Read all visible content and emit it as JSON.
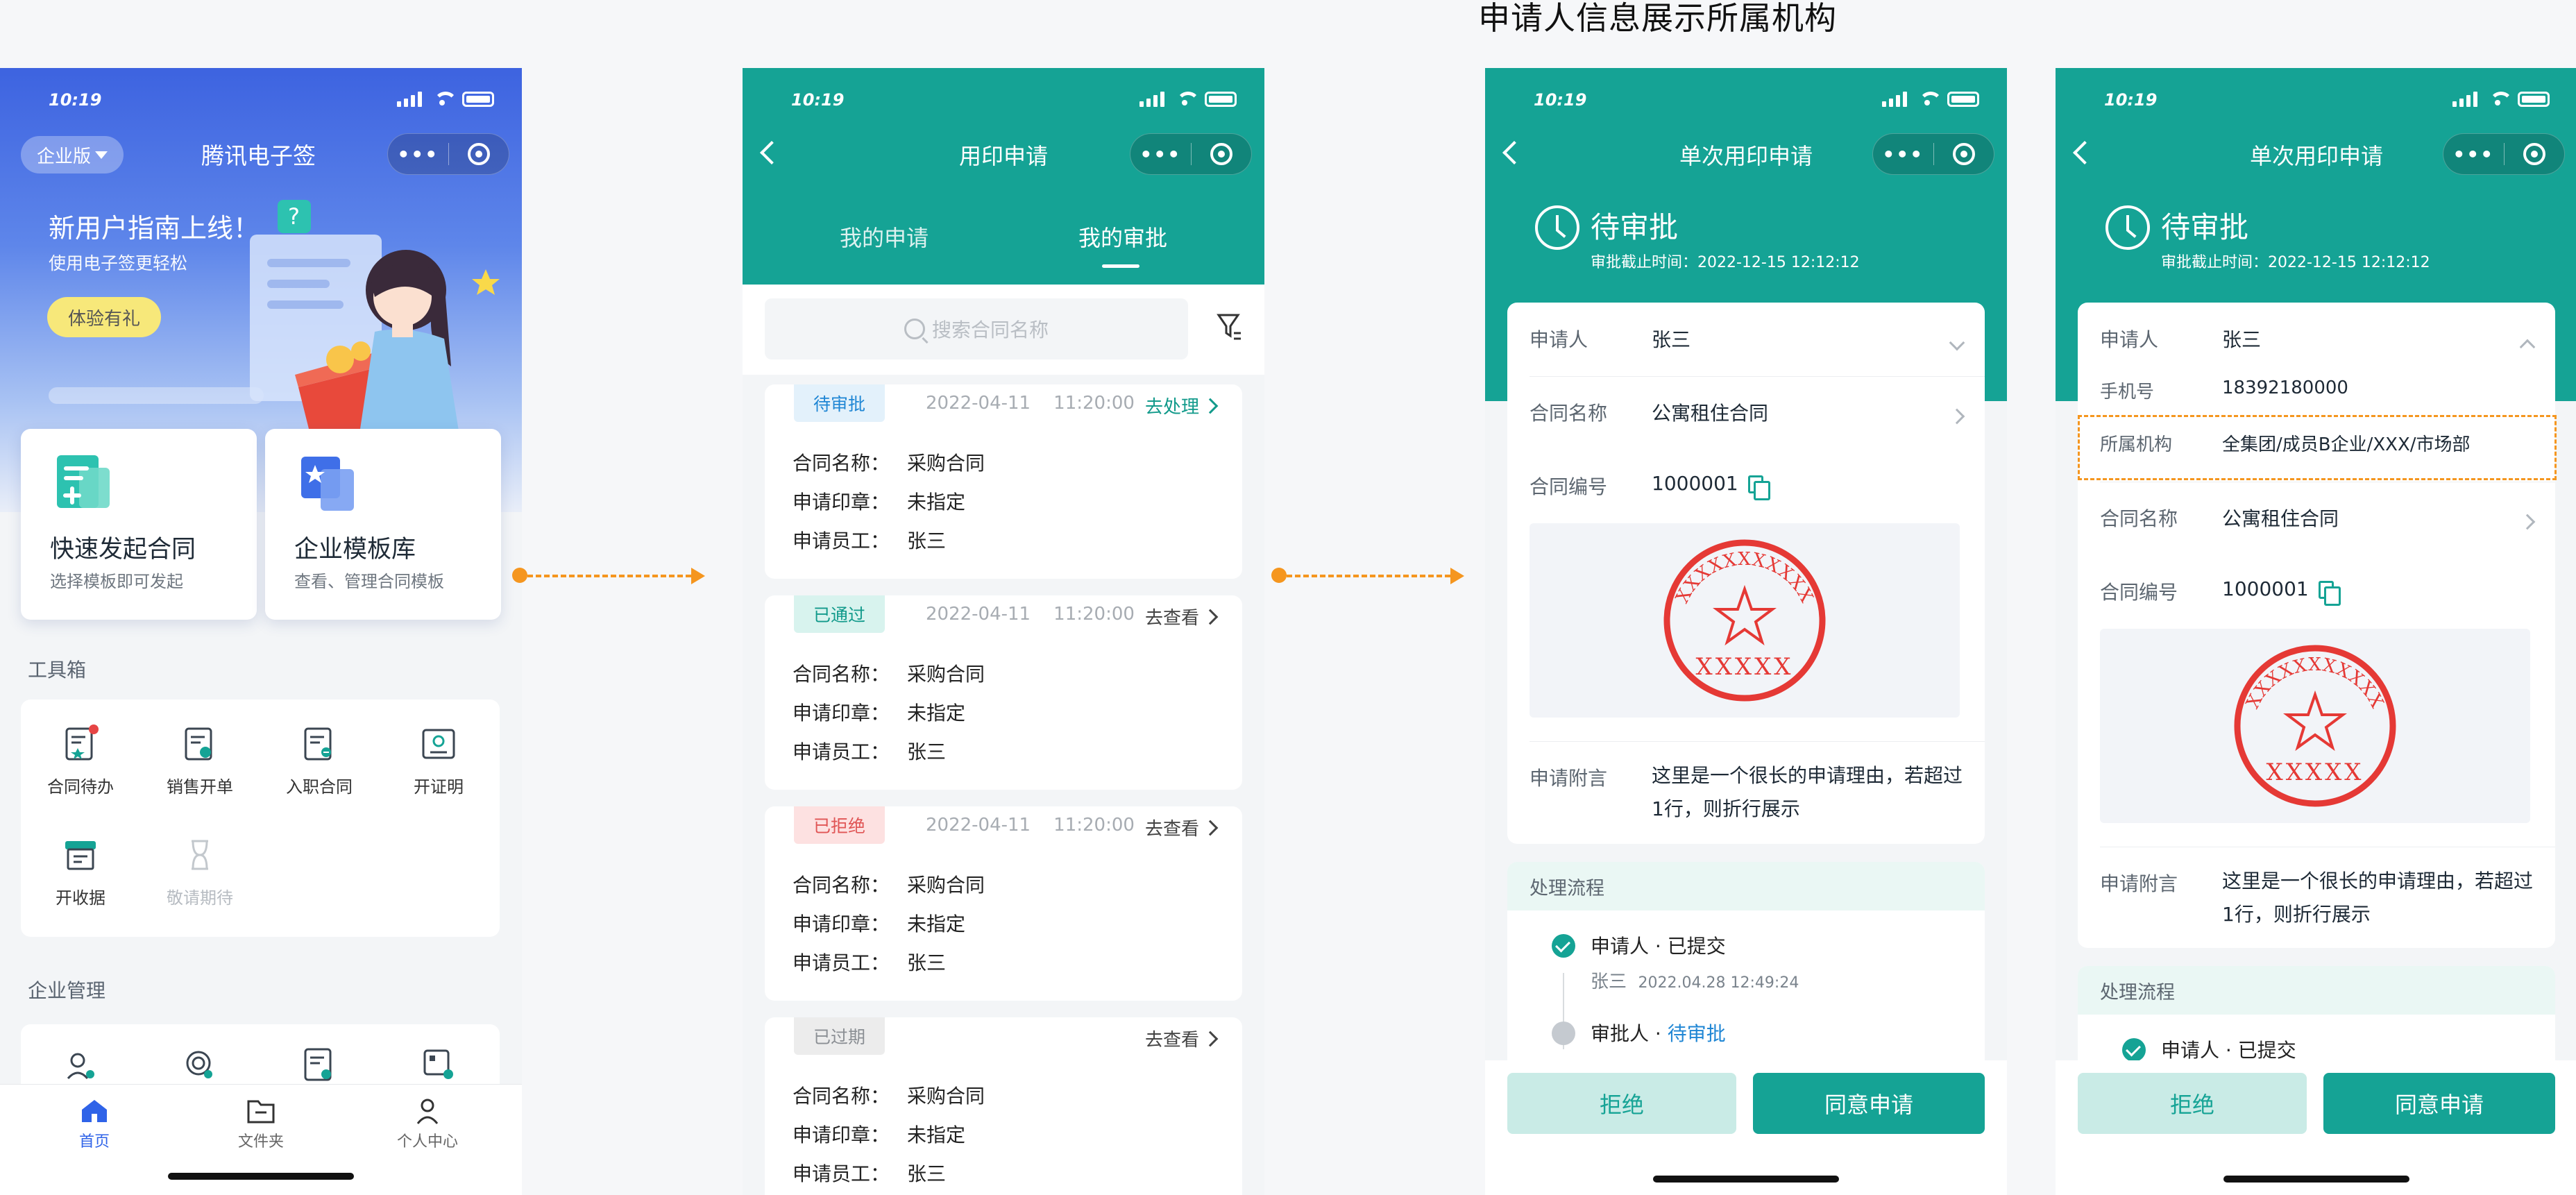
{
  "caption": "申请人信息展示所属机构",
  "status_time": "10:19",
  "capsule_dots": "•••",
  "phone1": {
    "edition": "企业版",
    "app_title": "腾讯电子签",
    "guide_title": "新用户指南上线！",
    "guide_sub": "使用电子签更轻松",
    "gift_btn": "体验有礼",
    "quick_cards": [
      {
        "title": "快速发起合同",
        "sub": "选择模板即可发起"
      },
      {
        "title": "企业模板库",
        "sub": "查看、管理合同模板"
      }
    ],
    "toolbox_label": "工具箱",
    "tools": [
      "合同待办",
      "销售开单",
      "入职合同",
      "开证明",
      "开收据",
      "敬请期待"
    ],
    "enterprise_label": "企业管理",
    "tabs": [
      "首页",
      "文件夹",
      "个人中心"
    ]
  },
  "phone2": {
    "title": "用印申请",
    "segments": [
      "我的申请",
      "我的审批"
    ],
    "search_placeholder": "搜索合同名称",
    "labels": {
      "contract": "合同名称：",
      "seal": "申请印章：",
      "staff": "申请员工："
    },
    "records": [
      {
        "status": "待审批",
        "date": "2022-04-11",
        "time": "11:20:00",
        "action": "去处理",
        "contract": "采购合同",
        "seal": "未指定",
        "staff": "张三"
      },
      {
        "status": "已通过",
        "date": "2022-04-11",
        "time": "11:20:00",
        "action": "去查看",
        "contract": "采购合同",
        "seal": "未指定",
        "staff": "张三"
      },
      {
        "status": "已拒绝",
        "date": "2022-04-11",
        "time": "11:20:00",
        "action": "去查看",
        "contract": "采购合同",
        "seal": "未指定",
        "staff": "张三"
      },
      {
        "status": "已过期",
        "date": "",
        "time": "",
        "action": "去查看",
        "contract": "采购合同",
        "seal": "未指定",
        "staff": "张三"
      }
    ]
  },
  "detail": {
    "title": "单次用印申请",
    "status": "待审批",
    "deadline": "审批截止时间：2022-12-15 12:12:12",
    "applicant_k": "申请人",
    "applicant_v": "张三",
    "phone_k": "手机号",
    "phone_v": "18392180000",
    "org_k": "所属机构",
    "org_v": "全集团/成员B企业/XXX/市场部",
    "contract_k": "合同名称",
    "contract_v": "公寓租住合同",
    "no_k": "合同编号",
    "no_v": "1000001",
    "seal_text": "XXXXX",
    "seal_ring": "XXXXXXXXXXX",
    "remark_k": "申请附言",
    "remark_v1": "这里是一个很长的申请理由，若超过",
    "remark_v2": "1行，则折行展示",
    "flow_title": "处理流程",
    "flow1_role": "申请人",
    "flow1_state": " · 已提交",
    "flow1_name": "张三",
    "flow1_time": "2022.04.28 12:49:24",
    "flow2_role": "审批人",
    "flow2_sep": " · ",
    "flow2_state": "待审批",
    "reject": "拒绝",
    "approve": "同意申请"
  },
  "colors": {
    "brand_teal": "#15a395",
    "accent_blue": "#2f63e8",
    "highlight_orange": "#f5961f"
  }
}
